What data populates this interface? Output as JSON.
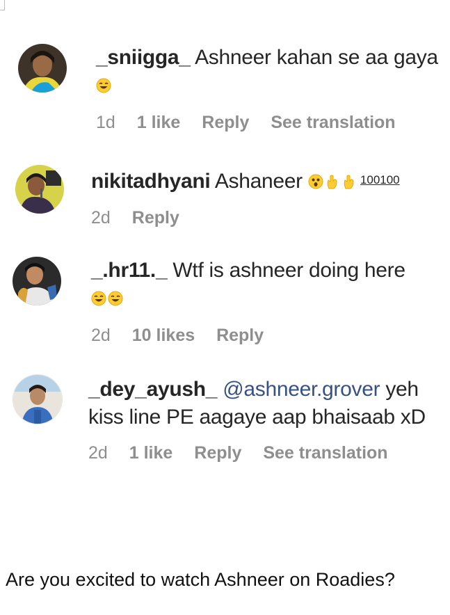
{
  "comments": [
    {
      "username": "_sniigga_",
      "text": "Ashneer kahan se aa gaya",
      "emojis": [
        "laughing-face"
      ],
      "meta": {
        "time": "1d",
        "likes": "1 like",
        "reply": "Reply",
        "translate": "See translation"
      }
    },
    {
      "username": "nikitadhyani",
      "text": "Ashaneer",
      "emojis": [
        "astonished-face",
        "hand",
        "hand"
      ],
      "score": "100100",
      "meta": {
        "time": "2d",
        "reply": "Reply"
      }
    },
    {
      "username": "_.hr11._",
      "text": "Wtf is ashneer doing here",
      "emojis": [
        "laughing-face",
        "laughing-face"
      ],
      "meta": {
        "time": "2d",
        "likes": "10 likes",
        "reply": "Reply"
      }
    },
    {
      "username": "_dey_ayush_",
      "mention": "@ashneer.grover",
      "text_line1": "yeh",
      "text_line2": "kiss line PE aagaye aap bhaisaab xD",
      "meta": {
        "time": "2d",
        "likes": "1 like",
        "reply": "Reply",
        "translate": "See translation"
      }
    }
  ],
  "caption": "Are you excited to watch Ashneer on Roadies?",
  "colors": {
    "username": "#262626",
    "meta": "#8e8e8e",
    "mention": "#385185",
    "emoji": "#FFCC33"
  }
}
